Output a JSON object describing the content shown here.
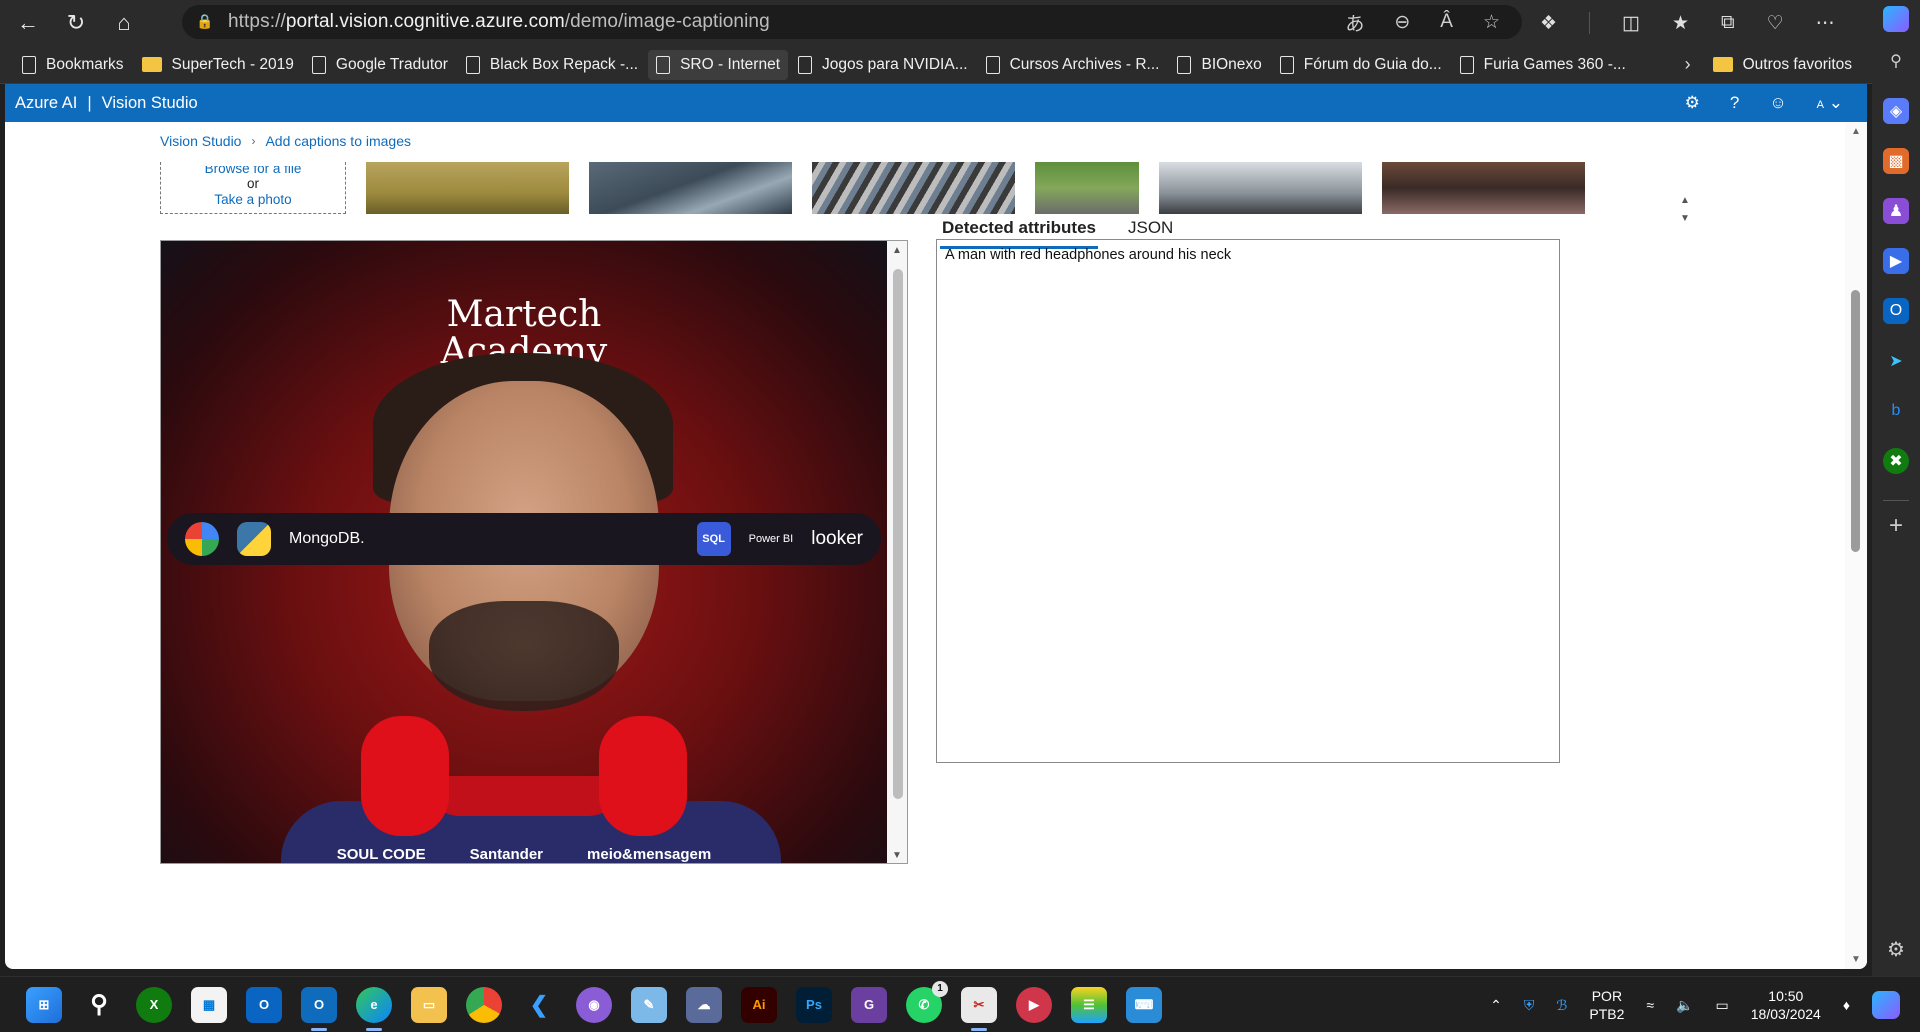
{
  "browser": {
    "url_scheme": "https://",
    "url_host": "portal.vision.cognitive.azure.com",
    "url_path": "/demo/image-captioning",
    "bookmarks": [
      {
        "label": "Bookmarks",
        "kind": "page"
      },
      {
        "label": "SuperTech - 2019",
        "kind": "folder"
      },
      {
        "label": "Google Tradutor",
        "kind": "page"
      },
      {
        "label": "Black Box Repack -...",
        "kind": "page"
      },
      {
        "label": "SRO - Internet",
        "kind": "page"
      },
      {
        "label": "Jogos para NVIDIA...",
        "kind": "page"
      },
      {
        "label": "Cursos Archives - R...",
        "kind": "page"
      },
      {
        "label": "BIOnexo",
        "kind": "page"
      },
      {
        "label": "Fórum do Guia do...",
        "kind": "page"
      },
      {
        "label": "Furia Games 360 -...",
        "kind": "page"
      }
    ],
    "other_favorites": "Outros favoritos",
    "icons": [
      "back-icon",
      "refresh-icon",
      "home-icon",
      "lock-icon",
      "translate-icon",
      "zoom-icon",
      "read-aloud-icon",
      "favorite-icon",
      "extensions-icon",
      "split-screen-icon",
      "favorites-icon",
      "collections-icon",
      "browser-essentials-icon",
      "more-icon",
      "copilot-icon"
    ]
  },
  "portal": {
    "brand": "Azure AI",
    "product": "Vision Studio",
    "avatar_initial": "A",
    "breadcrumb": [
      "Vision Studio",
      "Add captions to images"
    ],
    "upload": {
      "browse_label": "Browse for a file",
      "or_label": "or",
      "photo_label": "Take a photo"
    },
    "tabs": [
      "Detected attributes",
      "JSON"
    ],
    "active_tab": "Detected attributes",
    "caption": "A man with red headphones around his neck"
  },
  "image": {
    "title_line1": "Martech",
    "title_line2": "Academy",
    "logos": [
      "MongoDB.",
      "SQL",
      "Power BI",
      "looker"
    ],
    "sponsors": [
      "SOUL CODE",
      "Santander",
      "meio&mensagem"
    ]
  },
  "taskbar": {
    "apps": [
      "start",
      "search",
      "xbox",
      "store",
      "outlook",
      "outlook-new",
      "edge",
      "file-explorer",
      "chrome",
      "vscode",
      "github-desktop",
      "notepad",
      "app",
      "illustrator",
      "photoshop",
      "pdf",
      "whatsapp",
      "snipping-tool",
      "clipchamp",
      "bluestacks",
      "keyboard"
    ],
    "whatsapp_badge": "1",
    "lang_line1": "POR",
    "lang_line2": "PTB2",
    "time": "10:50",
    "date": "18/03/2024"
  }
}
